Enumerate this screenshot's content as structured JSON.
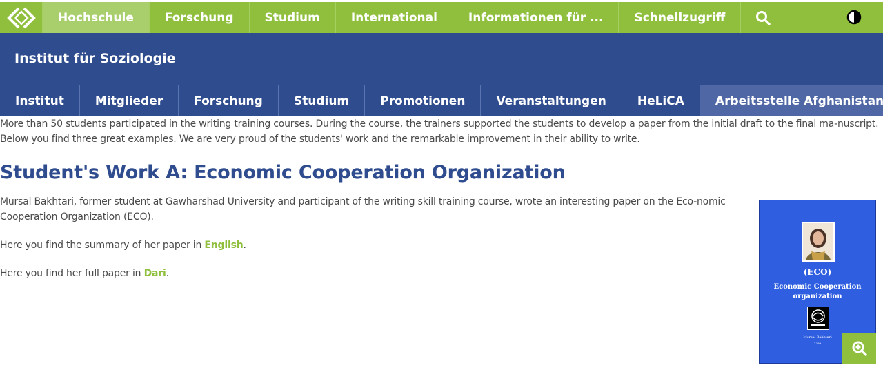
{
  "colors": {
    "green": "#8fbf3d",
    "blue": "#2f4c8f",
    "active_blue": "#4f68a5",
    "link": "#8fbf3d"
  },
  "topnav": {
    "logo_icon": "diamond-chevrons-logo",
    "items": [
      {
        "label": "Hochschule",
        "active": true
      },
      {
        "label": "Forschung"
      },
      {
        "label": "Studium"
      },
      {
        "label": "International"
      },
      {
        "label": "Informationen für ..."
      },
      {
        "label": "Schnellzugriff"
      }
    ],
    "search_icon": "search-icon",
    "contrast_icon": "contrast-icon"
  },
  "institute": {
    "title": "Institut für Soziologie"
  },
  "subnav": {
    "items": [
      {
        "label": "Institut"
      },
      {
        "label": "Mitglieder"
      },
      {
        "label": "Forschung"
      },
      {
        "label": "Studium"
      },
      {
        "label": "Promotionen"
      },
      {
        "label": "Veranstaltungen"
      },
      {
        "label": "HeLiCA"
      },
      {
        "label": "Arbeitsstelle Afghanistan",
        "active": true
      }
    ]
  },
  "content": {
    "intro": "More than 50 students participated in the writing training courses. During the course, the trainers supported the students to develop a paper from the initial draft to the final ma-nuscript. Below you find three great examples. We are very proud of the students' work and the remarkable improvement in their ability to write.",
    "heading": "Student's Work A: Economic Cooperation Organization",
    "p1": "Mursal Bakhtari, former student at Gawharshad University and participant of the writing skill training course, wrote an interesting paper on the Eco-nomic Cooperation Organization (ECO).",
    "p2_prefix": "Here you find the summary of her paper in ",
    "p2_link": "English",
    "p2_suffix": ".",
    "p3_prefix": "Here you find her full paper in ",
    "p3_link": "Dari",
    "p3_suffix": "."
  },
  "cover": {
    "title_line1": "(ECO)",
    "title_line2": "Economic Cooperation",
    "title_line3": "organization",
    "author": "Mursal Bakhtari",
    "date": "1399",
    "zoom_icon": "zoom-in-icon"
  }
}
